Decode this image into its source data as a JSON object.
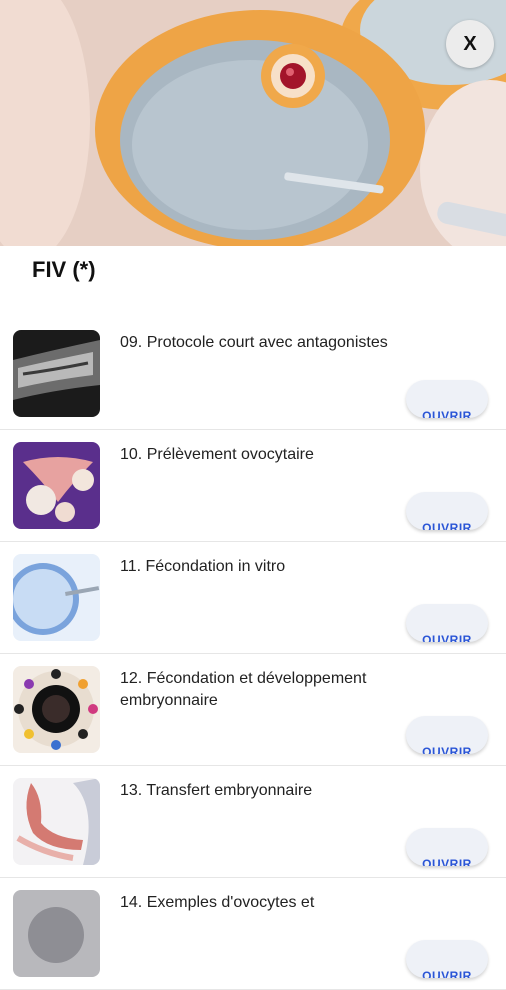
{
  "hero": {
    "close_label": "X",
    "image_icon": "ivf-oocyte-illustration"
  },
  "header": {
    "title": "FIV (*)"
  },
  "items": [
    {
      "label": "09. Protocole court avec antagonistes",
      "button": "OUVRIR",
      "icon": "ultrasound-thumbnail"
    },
    {
      "label": "10. Prélèvement ovocytaire",
      "button": "OUVRIR",
      "icon": "ovary-thumbnail"
    },
    {
      "label": "11. Fécondation in vitro",
      "button": "OUVRIR",
      "icon": "fertilization-thumbnail"
    },
    {
      "label": "12. Fécondation et développement embryonnaire",
      "button": "OUVRIR",
      "icon": "embryo-development-thumbnail"
    },
    {
      "label": "13. Transfert embryonnaire",
      "button": "OUVRIR",
      "icon": "embryo-transfer-thumbnail"
    },
    {
      "label": "14. Exemples d'ovocytes et",
      "button": "OUVRIR",
      "icon": "oocyte-examples-thumbnail"
    }
  ]
}
